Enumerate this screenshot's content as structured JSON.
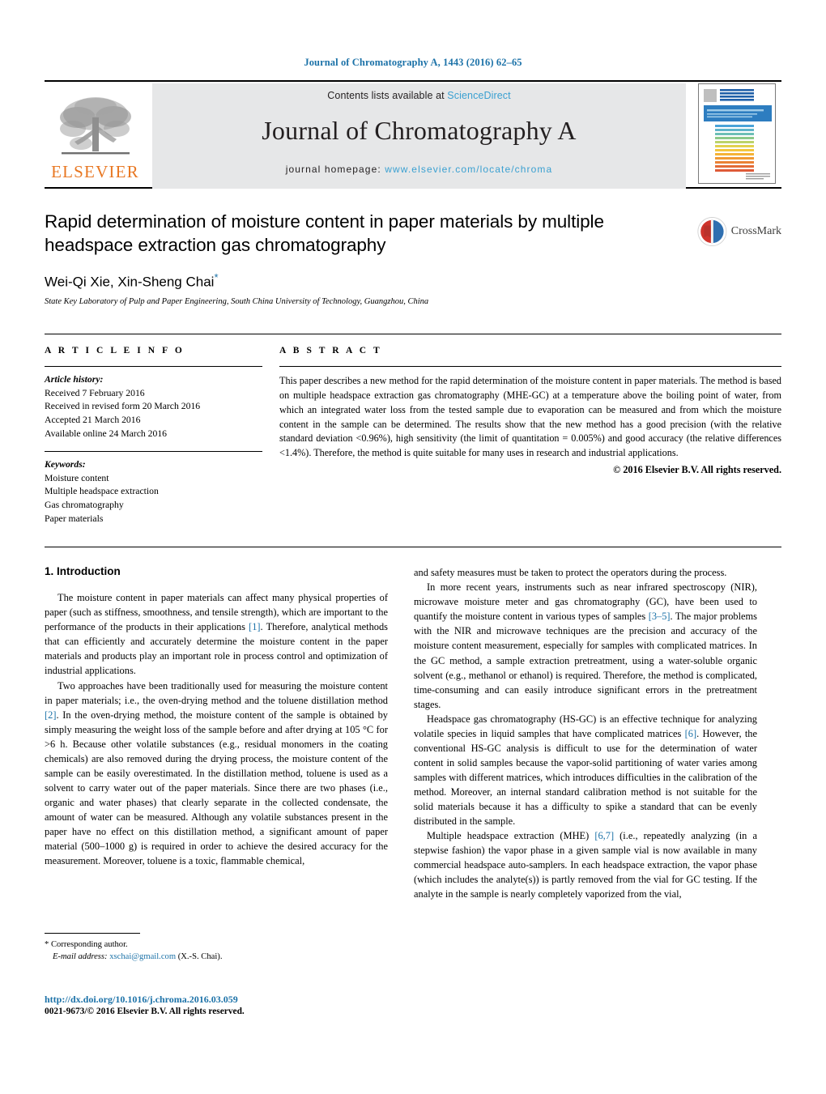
{
  "running_head": "Journal of Chromatography A, 1443 (2016) 62–65",
  "masthead": {
    "contents_prefix": "Contents lists available at ",
    "sciencedirect": "ScienceDirect",
    "journal_title": "Journal of Chromatography A",
    "homepage_prefix": "journal homepage: ",
    "homepage_url": "www.elsevier.com/locate/chroma",
    "publisher_logo_text": "ELSEVIER",
    "cover_title": "JOURNAL OF CHROMATOGRAPHY A",
    "cover_subtitle": "INCLUDING ELECTROPHORESIS AND OTHER SEPARATION METHODS"
  },
  "crossmark": {
    "label": "CrossMark"
  },
  "article": {
    "title": "Rapid determination of moisture content in paper materials by multiple headspace extraction gas chromatography",
    "authors": "Wei-Qi Xie, Xin-Sheng Chai",
    "corresponding_marker": "*",
    "affiliation": "State Key Laboratory of Pulp and Paper Engineering, South China University of Technology, Guangzhou, China"
  },
  "article_info": {
    "heading": "A R T I C L E    I N F O",
    "history_label": "Article history:",
    "history": [
      "Received 7 February 2016",
      "Received in revised form 20 March 2016",
      "Accepted 21 March 2016",
      "Available online 24 March 2016"
    ],
    "keywords_label": "Keywords:",
    "keywords": [
      "Moisture content",
      "Multiple headspace extraction",
      "Gas chromatography",
      "Paper materials"
    ]
  },
  "abstract": {
    "heading": "A B S T R A C T",
    "text": "This paper describes a new method for the rapid determination of the moisture content in paper materials. The method is based on multiple headspace extraction gas chromatography (MHE-GC) at a temperature above the boiling point of water, from which an integrated water loss from the tested sample due to evaporation can be measured and from which the moisture content in the sample can be determined. The results show that the new method has a good precision (with the relative standard deviation <0.96%), high sensitivity (the limit of quantitation = 0.005%) and good accuracy (the relative differences <1.4%). Therefore, the method is quite suitable for many uses in research and industrial applications.",
    "copyright": "© 2016 Elsevier B.V. All rights reserved."
  },
  "body": {
    "section_heading": "1.  Introduction",
    "left": {
      "p1_a": "The moisture content in paper materials can affect many physical properties of paper (such as stiffness, smoothness, and tensile strength), which are important to the performance of the products in their applications ",
      "p1_cite": "[1]",
      "p1_b": ". Therefore, analytical methods that can efficiently and accurately determine the moisture content in the paper materials and products play an important role in process control and optimization of industrial applications.",
      "p2_a": "Two approaches have been traditionally used for measuring the moisture content in paper materials; i.e., the oven-drying method and the toluene distillation method ",
      "p2_cite": "[2]",
      "p2_b": ". In the oven-drying method, the moisture content of the sample is obtained by simply measuring the weight loss of the sample before and after drying at 105 °C for >6 h. Because other volatile substances (e.g., residual monomers in the coating chemicals) are also removed during the drying process, the moisture content of the sample can be easily overestimated. In the distillation method, toluene is used as a solvent to carry water out of the paper materials. Since there are two phases (i.e., organic and water phases) that clearly separate in the collected condensate, the amount of water can be measured. Although any volatile substances present in the paper have no effect on this distillation method, a significant amount of paper material (500–1000 g) is required in order to achieve the desired accuracy for the measurement. Moreover, toluene is a toxic, flammable chemical,"
    },
    "right": {
      "p1": "and safety measures must be taken to protect the operators during the process.",
      "p2_a": "In more recent years, instruments such as near infrared spectroscopy (NIR), microwave moisture meter and gas chromatography (GC), have been used to quantify the moisture content in various types of samples ",
      "p2_cite": "[3–5]",
      "p2_b": ". The major problems with the NIR and microwave techniques are the precision and accuracy of the moisture content measurement, especially for samples with complicated matrices. In the GC method, a sample extraction pretreatment, using a water-soluble organic solvent (e.g., methanol or ethanol) is required. Therefore, the method is complicated, time-consuming and can easily introduce significant errors in the pretreatment stages.",
      "p3_a": "Headspace gas chromatography (HS-GC) is an effective technique for analyzing volatile species in liquid samples that have complicated matrices ",
      "p3_cite": "[6]",
      "p3_b": ". However, the conventional HS-GC analysis is difficult to use for the determination of water content in solid samples because the vapor-solid partitioning of water varies among samples with different matrices, which introduces difficulties in the calibration of the method. Moreover, an internal standard calibration method is not suitable for the solid materials because it has a difficulty to spike a standard that can be evenly distributed in the sample.",
      "p4_a": "Multiple headspace extraction (MHE) ",
      "p4_cite": "[6,7]",
      "p4_b": " (i.e., repeatedly analyzing (in a stepwise fashion) the vapor phase in a given sample vial is now available in many commercial headspace auto-samplers. In each headspace extraction, the vapor phase (which includes the analyte(s)) is partly removed from the vial for GC testing. If the analyte in the sample is nearly completely vaporized from the vial,"
    }
  },
  "footnote": {
    "marker": "*",
    "corresponding": "Corresponding author.",
    "email_label": "E-mail address:",
    "email": "xschai@gmail.com",
    "email_suffix": "(X.-S. Chai)."
  },
  "footer": {
    "doi": "http://dx.doi.org/10.1016/j.chroma.2016.03.059",
    "issn_copyright": "0021-9673/© 2016 Elsevier B.V. All rights reserved."
  },
  "colors": {
    "link_blue": "#1c72a8",
    "sciencedirect_blue": "#3aa0d1",
    "elsevier_orange": "#E87722",
    "masthead_grey": "#e6e7e8"
  }
}
